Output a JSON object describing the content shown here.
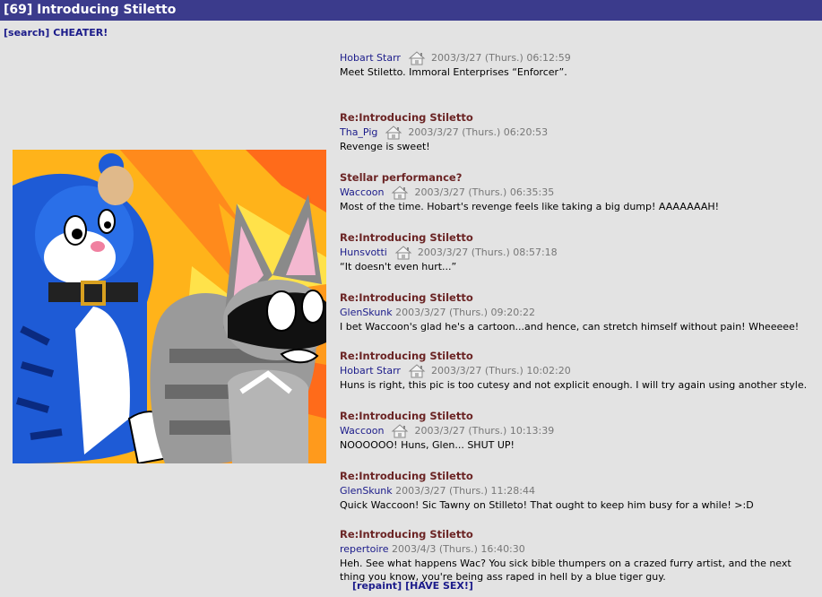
{
  "header": {
    "title": "[69] Introducing Stiletto"
  },
  "top_links": {
    "search": "[search]",
    "cheater": "CHEATER!"
  },
  "posts": [
    {
      "subject": "",
      "author": "Hobart Starr",
      "home": true,
      "date": "2003/3/27 (Thurs.) 06:12:59",
      "body": "Meet Stiletto. Immoral Enterprises “Enforcer”."
    },
    {
      "subject": "Re:Introducing Stiletto",
      "author": "Tha_Pig",
      "home": true,
      "date": "2003/3/27 (Thurs.) 06:20:53",
      "body": "Revenge is sweet!"
    },
    {
      "subject": "Stellar performance?",
      "author": "Waccoon",
      "home": true,
      "date": "2003/3/27 (Thurs.) 06:35:35",
      "body": "Most of the time. Hobart's revenge feels like taking a big dump! AAAAAAAH!"
    },
    {
      "subject": "Re:Introducing Stiletto",
      "author": "Hunsvotti",
      "home": true,
      "date": "2003/3/27 (Thurs.) 08:57:18",
      "body": "“It doesn't even hurt...”"
    },
    {
      "subject": "Re:Introducing Stiletto",
      "author": "GlenSkunk",
      "home": false,
      "date": "2003/3/27 (Thurs.) 09:20:22",
      "body": "I bet Waccoon's glad he's a cartoon...and hence, can stretch himself without pain! Wheeeee!"
    },
    {
      "subject": "Re:Introducing Stiletto",
      "author": "Hobart Starr",
      "home": true,
      "date": "2003/3/27 (Thurs.) 10:02:20",
      "body": "Huns is right, this pic is too cutesy and not explicit enough. I will try again using another style."
    },
    {
      "subject": "Re:Introducing Stiletto",
      "author": "Waccoon",
      "home": true,
      "date": "2003/3/27 (Thurs.) 10:13:39",
      "body": "NOOOOOO! Huns, Glen... SHUT UP!"
    },
    {
      "subject": "Re:Introducing Stiletto",
      "author": "GlenSkunk",
      "home": false,
      "date": "2003/3/27 (Thurs.) 11:28:44",
      "body": "Quick Waccoon! Sic Tawny on Stilleto! That ought to keep him busy for a while! >:D"
    },
    {
      "subject": "Re:Introducing Stiletto",
      "author": "repertoire",
      "home": false,
      "date": "2003/4/3 (Thurs.) 16:40:30",
      "body": "Heh. See what happens Wac? You sick bible thumpers on a crazed furry artist, and the next thing you know, you're being ass raped in hell by a blue tiger guy."
    }
  ],
  "bottom_links": {
    "repaint": "[repaint]",
    "have_sex": "[HAVE SEX!]"
  }
}
